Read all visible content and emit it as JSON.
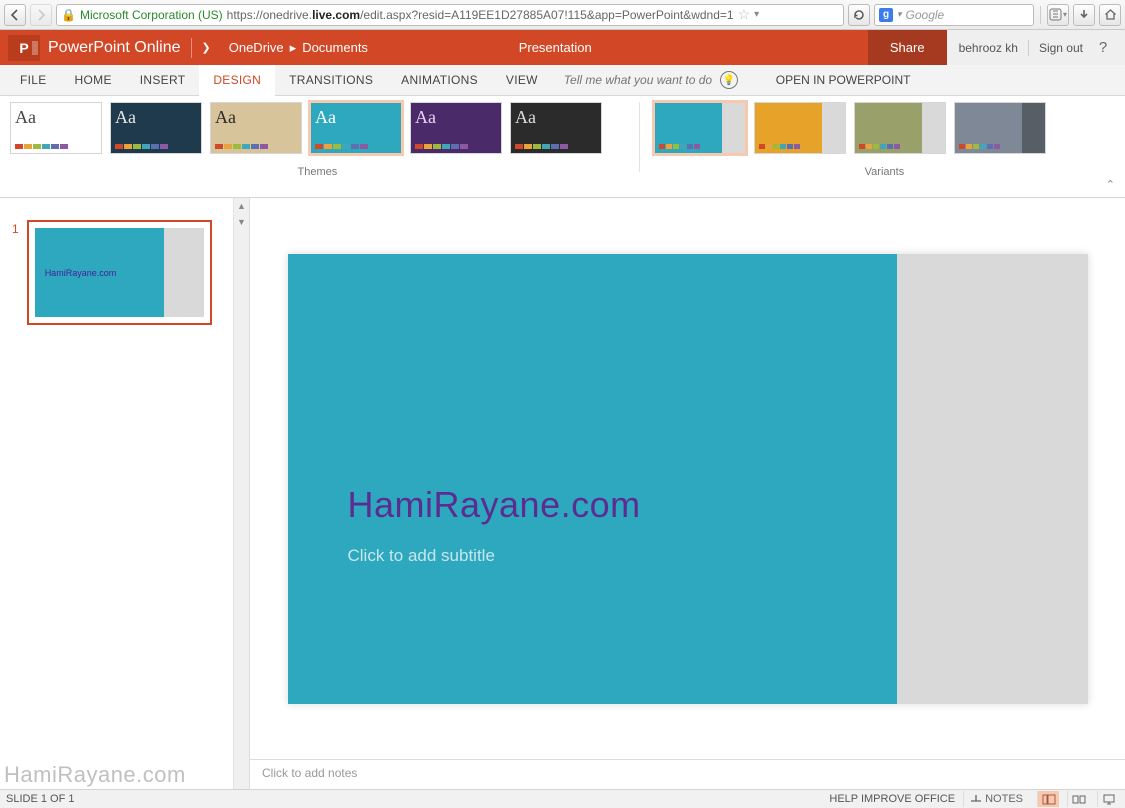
{
  "browser": {
    "identity": "Microsoft Corporation (US)",
    "url_prefix": "https://onedrive.",
    "url_bold": "live.com",
    "url_suffix": "/edit.aspx?resid=A119EE1D27885A07!115&app=PowerPoint&wdnd=1",
    "search_placeholder": "Google",
    "search_badge": "g"
  },
  "header": {
    "app_name": "PowerPoint Online",
    "logo_text": "P",
    "breadcrumb": {
      "root": "OneDrive",
      "folder": "Documents"
    },
    "doc_title": "Presentation",
    "share": "Share",
    "user": "behrooz kh",
    "signout": "Sign out",
    "help": "?"
  },
  "ribbon": {
    "tabs": [
      "FILE",
      "HOME",
      "INSERT",
      "DESIGN",
      "TRANSITIONS",
      "ANIMATIONS",
      "VIEW"
    ],
    "active_tab_index": 3,
    "tellme_placeholder": "Tell me what you want to do",
    "open_in": "OPEN IN POWERPOINT",
    "themes_label": "Themes",
    "variants_label": "Variants",
    "themes": [
      {
        "bg": "#ffffff",
        "fg": "#444",
        "swatch": [
          "#d04828",
          "#e8a33d",
          "#9cba3c",
          "#3fa7b8",
          "#5c6fb1",
          "#8c5aa3"
        ]
      },
      {
        "bg": "#1e3a4c",
        "fg": "#e6e6e6",
        "swatch": [
          "#d04828",
          "#e8a33d",
          "#9cba3c",
          "#3fa7b8",
          "#5c6fb1",
          "#8c5aa3"
        ]
      },
      {
        "bg": "#d8c49a",
        "fg": "#2b2b2b",
        "swatch": [
          "#d04828",
          "#e8a33d",
          "#9cba3c",
          "#3fa7b8",
          "#5c6fb1",
          "#8c5aa3"
        ]
      },
      {
        "bg": "#2ea8bf",
        "fg": "#ffffff",
        "swatch": [
          "#d04828",
          "#e8a33d",
          "#9cba3c",
          "#3fa7b8",
          "#5c6fb1",
          "#8c5aa3"
        ],
        "selected": true
      },
      {
        "bg": "#4a2a68",
        "fg": "#e8d7f4",
        "swatch": [
          "#d04828",
          "#e8a33d",
          "#9cba3c",
          "#3fa7b8",
          "#5c6fb1",
          "#8c5aa3"
        ]
      },
      {
        "bg": "#2b2b2b",
        "fg": "#dddddd",
        "swatch": [
          "#d04828",
          "#e8a33d",
          "#9cba3c",
          "#3fa7b8",
          "#5c6fb1",
          "#8c5aa3"
        ]
      }
    ],
    "variants": [
      {
        "main": "#2ea8bf",
        "side": "#d9d9d9",
        "swatch": [
          "#d04828",
          "#e8a33d",
          "#9cba3c",
          "#3fa7b8",
          "#5c6fb1",
          "#8c5aa3"
        ],
        "selected": true
      },
      {
        "main": "#e6a229",
        "side": "#d9d9d9",
        "swatch": [
          "#d04828",
          "#e8a33d",
          "#9cba3c",
          "#3fa7b8",
          "#5c6fb1",
          "#8c5aa3"
        ]
      },
      {
        "main": "#9aa06a",
        "side": "#d9d9d9",
        "swatch": [
          "#d04828",
          "#e8a33d",
          "#9cba3c",
          "#3fa7b8",
          "#5c6fb1",
          "#8c5aa3"
        ]
      },
      {
        "main": "#7f8896",
        "side": "#585e66",
        "swatch": [
          "#d04828",
          "#e8a33d",
          "#9cba3c",
          "#3fa7b8",
          "#5c6fb1",
          "#8c5aa3"
        ]
      }
    ]
  },
  "slides": {
    "items": [
      {
        "number": "1",
        "title": "HamiRayane.com"
      }
    ]
  },
  "canvas": {
    "title": "HamiRayane.com",
    "subtitle_placeholder": "Click to add subtitle"
  },
  "notes": {
    "placeholder": "Click to add notes"
  },
  "status": {
    "slide_info": "SLIDE 1 OF 1",
    "help_improve": "HELP IMPROVE OFFICE",
    "notes_btn": "NOTES"
  },
  "watermark": "HamiRayane.com"
}
